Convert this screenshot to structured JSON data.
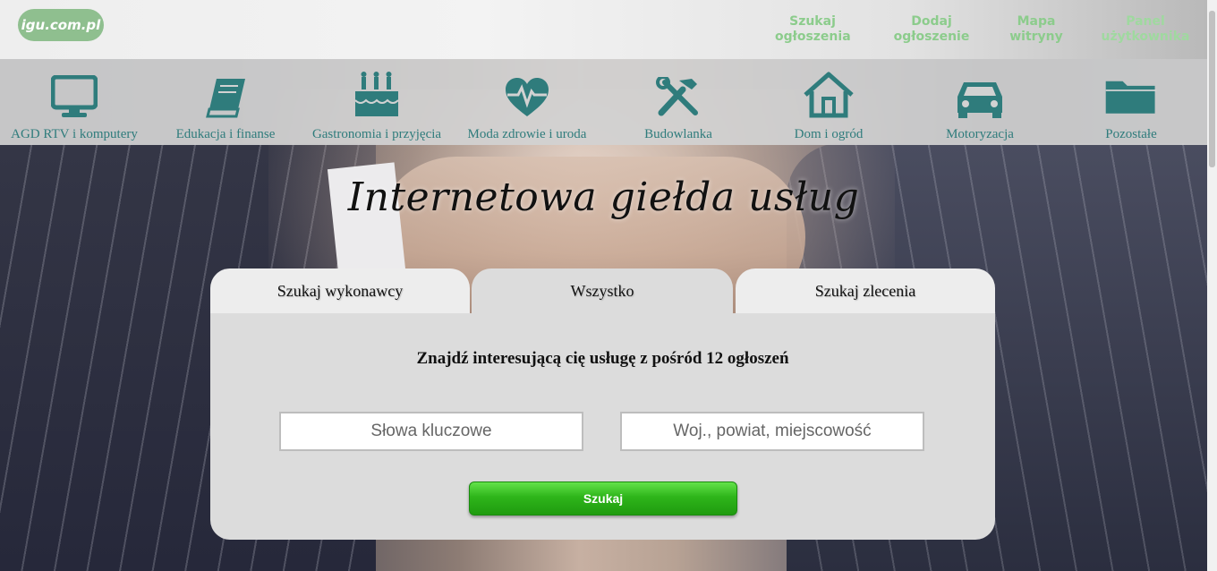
{
  "logo": {
    "text": "igu.com.pl"
  },
  "topnav": [
    {
      "label": "Szukaj\nogłoszenia"
    },
    {
      "label": "Dodaj\nogłoszenie"
    },
    {
      "label": "Mapa\nwitryny"
    },
    {
      "label": "Panel\nużytkownika"
    }
  ],
  "categories": [
    {
      "label": "AGD RTV i komputery",
      "icon": "monitor-icon"
    },
    {
      "label": "Edukacja i finanse",
      "icon": "book-icon"
    },
    {
      "label": "Gastronomia i przyjęcia",
      "icon": "cake-icon"
    },
    {
      "label": "Moda zdrowie i uroda",
      "icon": "heart-pulse-icon"
    },
    {
      "label": "Budowlanka",
      "icon": "tools-icon"
    },
    {
      "label": "Dom i ogród",
      "icon": "house-icon"
    },
    {
      "label": "Motoryzacja",
      "icon": "car-icon"
    },
    {
      "label": "Pozostałe",
      "icon": "folder-icon"
    }
  ],
  "hero": {
    "title": "Internetowa giełda usług"
  },
  "search": {
    "tabs": [
      {
        "label": "Szukaj wykonawcy"
      },
      {
        "label": "Wszystko"
      },
      {
        "label": "Szukaj zlecenia"
      }
    ],
    "headline": "Znajdź interesującą cię usługę z pośród 12 ogłoszeń",
    "keywords_placeholder": "Słowa kluczowe",
    "location_placeholder": "Woj., powiat, miejscowość",
    "button_label": "Szukaj"
  },
  "colors": {
    "icon": "#2f7c7c",
    "nav": "#8ccc8c",
    "button": "#2eb51a"
  }
}
